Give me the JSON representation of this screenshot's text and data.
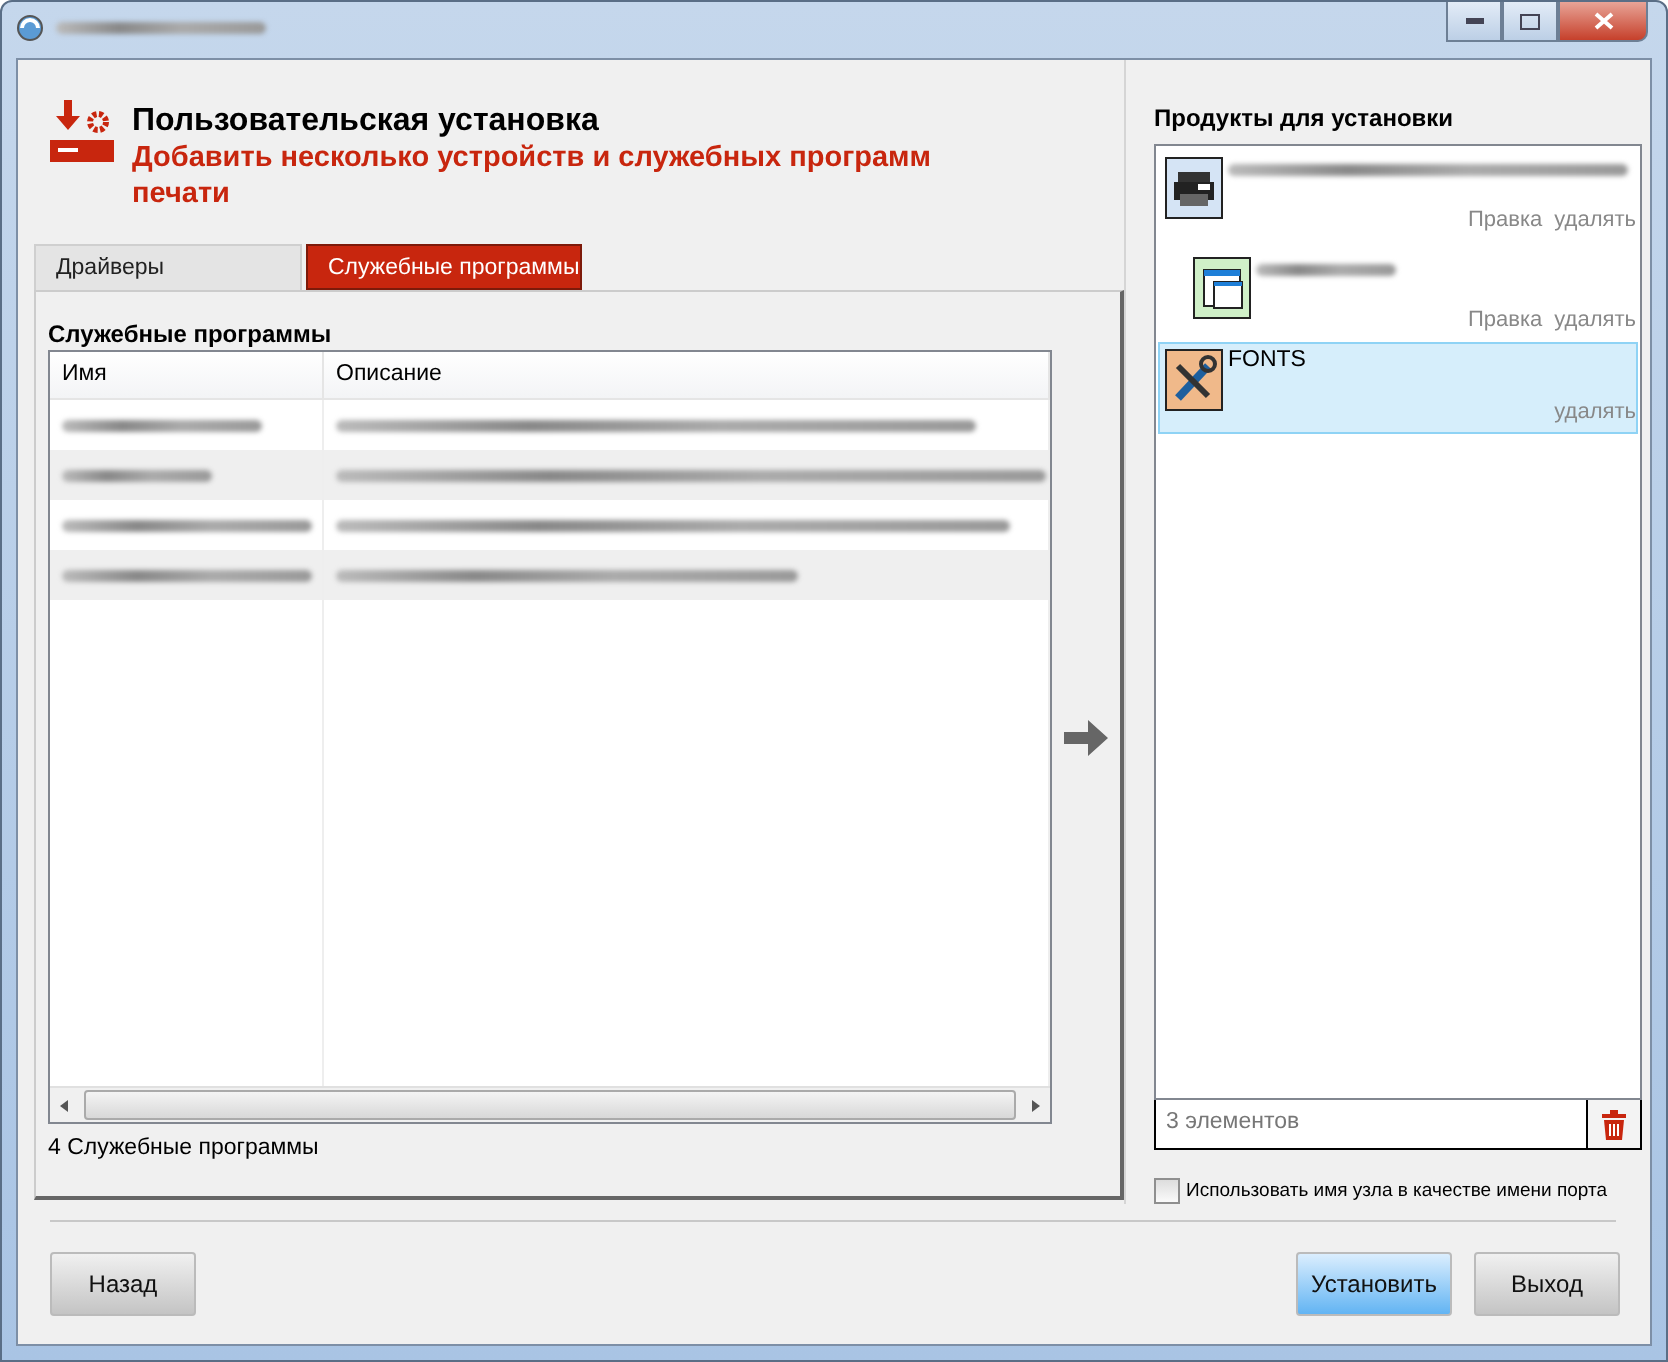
{
  "header": {
    "title": "Пользовательская установка",
    "subtitle": "Добавить несколько устройств и служебных программ печати"
  },
  "tabs": [
    {
      "label": "Драйверы",
      "selected": false
    },
    {
      "label": "Служебные программы",
      "selected": true
    }
  ],
  "utilities": {
    "heading": "Служебные программы",
    "columns": [
      "Имя",
      "Описание"
    ],
    "rows": [
      {
        "kind": "redacted"
      },
      {
        "kind": "redacted"
      },
      {
        "kind": "redacted"
      },
      {
        "kind": "redacted"
      }
    ],
    "count": "4 Служебные программы"
  },
  "products": {
    "heading": "Продукты для установки",
    "items": [
      {
        "kind": "printer",
        "actions": [
          "Правка",
          "удалять"
        ],
        "selected": false,
        "children": [
          {
            "kind": "program",
            "actions": [
              "Правка",
              "удалять"
            ],
            "selected": false
          }
        ]
      },
      {
        "kind": "tools",
        "name": "FONTS",
        "actions": [
          "удалять"
        ],
        "selected": true
      }
    ],
    "count": "3 элементов"
  },
  "port_option": {
    "label": "Использовать имя узла в качестве имени порта",
    "checked": false
  },
  "buttons": [
    {
      "label": "Назад",
      "kind": "normal"
    },
    {
      "label": "Установить",
      "kind": "primary"
    },
    {
      "label": "Выход",
      "kind": "normal"
    }
  ]
}
